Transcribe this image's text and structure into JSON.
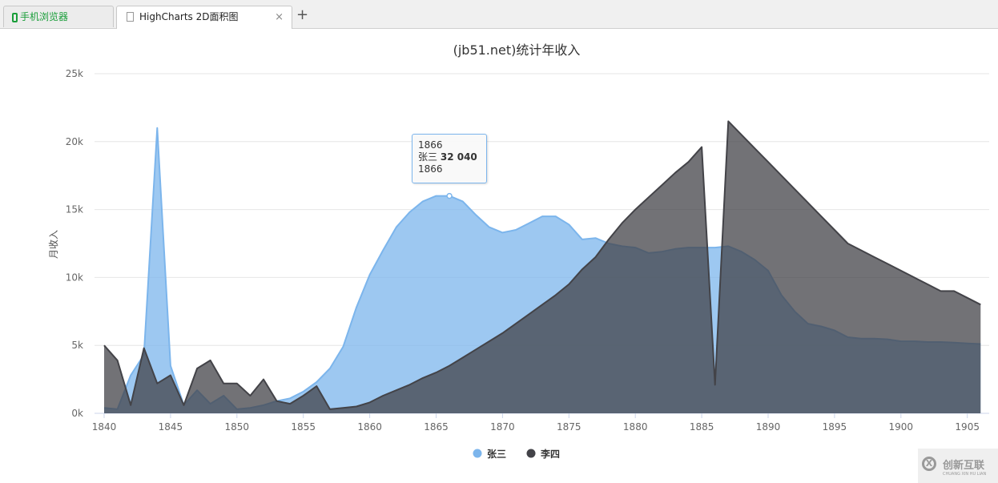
{
  "browser": {
    "tabs": [
      {
        "label": "手机浏览器",
        "icon": "phone-icon"
      },
      {
        "label": "HighCharts 2D面积图",
        "icon": "document-icon"
      }
    ],
    "close_label": "×",
    "new_tab_label": "+"
  },
  "chart_data": {
    "type": "area",
    "title": "(jb51.net)统计年收入",
    "ylabel": "月收入",
    "xlabel": "",
    "xlim": [
      1840,
      1906
    ],
    "ylim": [
      0,
      25000
    ],
    "x_ticks": [
      "1840",
      "1845",
      "1850",
      "1855",
      "1860",
      "1865",
      "1870",
      "1875",
      "1880",
      "1885",
      "1890",
      "1895",
      "1900",
      "1905"
    ],
    "y_ticks": [
      "0k",
      "5k",
      "10k",
      "15k",
      "20k",
      "25k"
    ],
    "grid": true,
    "legend": "bottom-center",
    "x": [
      1840,
      1841,
      1842,
      1843,
      1844,
      1845,
      1846,
      1847,
      1848,
      1849,
      1850,
      1851,
      1852,
      1853,
      1854,
      1855,
      1856,
      1857,
      1858,
      1859,
      1860,
      1861,
      1862,
      1863,
      1864,
      1865,
      1866,
      1867,
      1868,
      1869,
      1870,
      1871,
      1872,
      1873,
      1874,
      1875,
      1876,
      1877,
      1878,
      1879,
      1880,
      1881,
      1882,
      1883,
      1884,
      1885,
      1886,
      1887,
      1888,
      1889,
      1890,
      1891,
      1892,
      1893,
      1894,
      1895,
      1896,
      1897,
      1898,
      1899,
      1900,
      1901,
      1902,
      1903,
      1904,
      1905,
      1906
    ],
    "series": [
      {
        "name": "张三",
        "color": "#7cb5ec",
        "values": [
          400,
          300,
          2800,
          4300,
          21000,
          3500,
          600,
          1700,
          700,
          1300,
          300,
          400,
          600,
          900,
          1100,
          1600,
          2300,
          3300,
          4900,
          7800,
          10200,
          12000,
          13700,
          14800,
          15600,
          16000,
          16000,
          15600,
          14600,
          13700,
          13300,
          13500,
          14000,
          14500,
          14500,
          13900,
          12800,
          12900,
          12500,
          12300,
          12200,
          11800,
          11900,
          12100,
          12200,
          12200,
          12200,
          12300,
          11900,
          11300,
          10500,
          8700,
          7500,
          6600,
          6400,
          6100,
          5600,
          5500,
          5500,
          5450,
          5300,
          5300,
          5250,
          5250,
          5200,
          5150,
          5100
        ]
      },
      {
        "name": "李四",
        "color": "#434348",
        "values": [
          5000,
          3900,
          600,
          4800,
          2200,
          2800,
          600,
          3300,
          3900,
          2200,
          2200,
          1300,
          2500,
          900,
          700,
          1300,
          2000,
          300,
          400,
          500,
          800,
          1300,
          1700,
          2100,
          2600,
          3000,
          3500,
          4100,
          4700,
          5300,
          5900,
          6600,
          7300,
          8000,
          8700,
          9500,
          10600,
          11500,
          12800,
          14000,
          15000,
          15900,
          16800,
          17700,
          18500,
          19600,
          2100,
          21500,
          20500,
          19500,
          18500,
          17500,
          16500,
          15500,
          14500,
          13500,
          12500,
          12000,
          11500,
          11000,
          10500,
          10000,
          9500,
          9000,
          9000,
          8500,
          8000
        ]
      }
    ],
    "tooltip": {
      "header": "1866",
      "series": "张三",
      "value": "32 040",
      "footer": "1866"
    }
  },
  "watermark": {
    "text": "创新互联",
    "sub": "CHUANG XIN HU LIAN"
  }
}
